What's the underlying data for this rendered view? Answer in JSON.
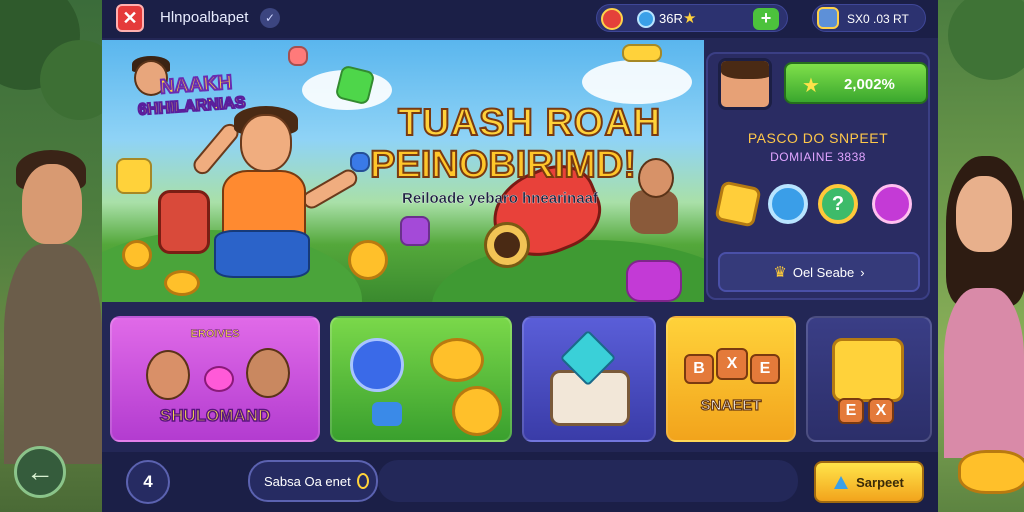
{
  "topbar": {
    "title": "Hlnpoalbapet",
    "currency_text": "36R",
    "profile_text": "SX0 .03 RT"
  },
  "banner": {
    "logo_line1": "NAAKH",
    "logo_line2": "6HHILARNIAS",
    "headline1": "TUASH ROAH",
    "headline2": "PEINOBIRIMD!",
    "subline": "Reiloade yebaro hnearinaaf"
  },
  "info_card": {
    "score": "2,002%",
    "title1": "PASCO DO SNPEET",
    "title2": "DOMIAINE 3838",
    "reward_label": "?",
    "button_label": "Oel Seabe"
  },
  "tiles": [
    {
      "top_label": "EROIVES",
      "bottom_label": "SHULOMAND"
    },
    {
      "bottom_label": ""
    },
    {
      "bottom_label": ""
    },
    {
      "bottom_label": "SNAEET"
    },
    {
      "bottom_label": ""
    }
  ],
  "bottombar": {
    "level": "4",
    "search_text": "Sabsa Oa enet",
    "play_label": "Sarpeet"
  },
  "icons": {
    "close": "close-icon",
    "verified": "check-icon",
    "add": "plus-icon",
    "back": "arrow-left-icon"
  },
  "colors": {
    "panel": "#232756",
    "accent_gold": "#ffd23a",
    "accent_green": "#4cc23c",
    "close_red": "#e53a3a"
  }
}
